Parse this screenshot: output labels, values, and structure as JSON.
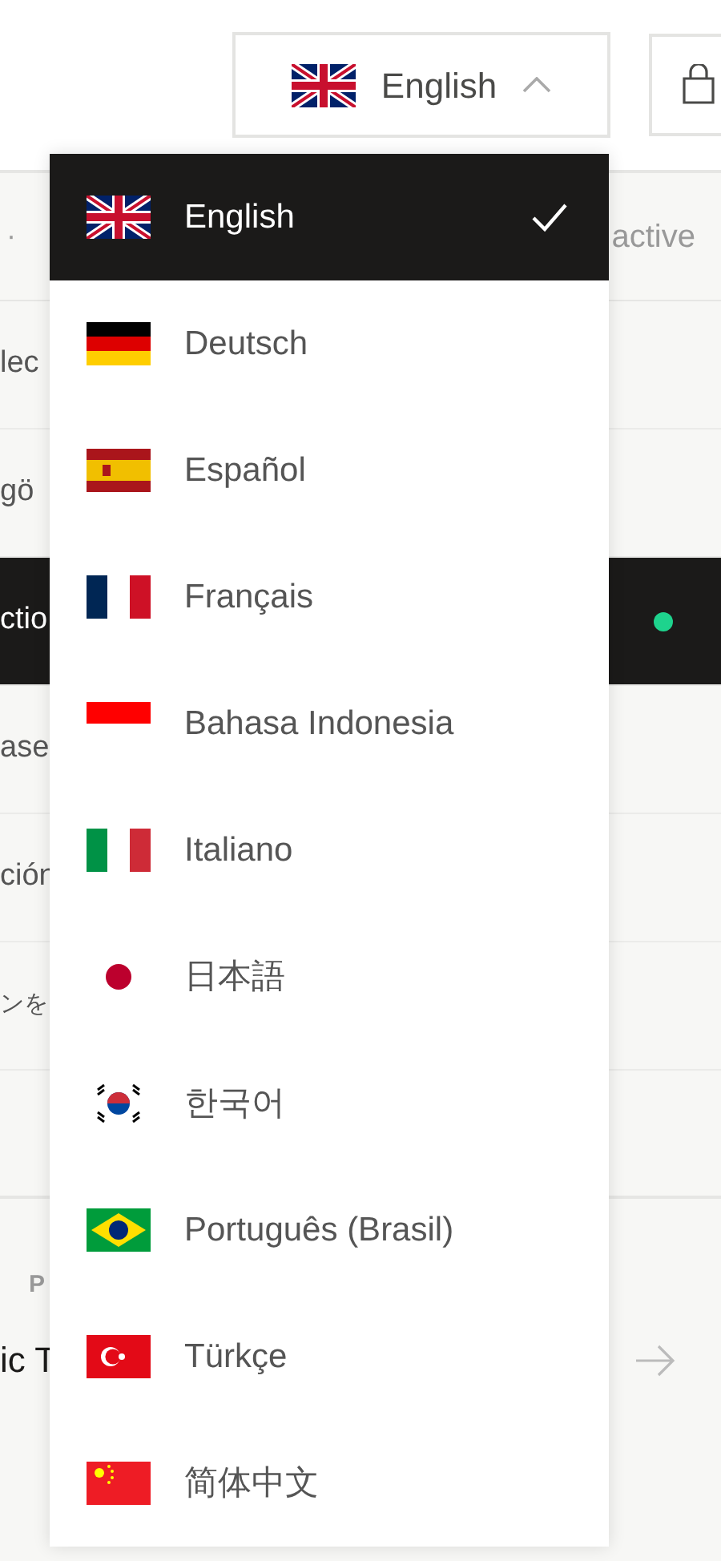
{
  "header": {
    "language_button": {
      "label": "English",
      "expanded": true
    }
  },
  "list": {
    "header_left": "·",
    "header_right": "active",
    "rows": [
      {
        "text": "lec",
        "selected": false,
        "active": false
      },
      {
        "text": "gö",
        "selected": false,
        "active": false
      },
      {
        "text": "ctio",
        "selected": true,
        "active": true
      },
      {
        "text": "ase",
        "selected": false,
        "active": false
      },
      {
        "text": "ción",
        "selected": false,
        "active": false
      },
      {
        "text": "ンを",
        "selected": false,
        "active": false
      }
    ]
  },
  "featured": {
    "label": "P",
    "title": "ic T"
  },
  "languages": [
    {
      "label": "English",
      "kind": "gb",
      "selected": true
    },
    {
      "label": "Deutsch",
      "kind": "de",
      "selected": false
    },
    {
      "label": "Español",
      "kind": "es",
      "selected": false
    },
    {
      "label": "Français",
      "kind": "fr",
      "selected": false
    },
    {
      "label": "Bahasa Indonesia",
      "kind": "id",
      "selected": false
    },
    {
      "label": "Italiano",
      "kind": "it",
      "selected": false
    },
    {
      "label": "日本語",
      "kind": "jp",
      "selected": false
    },
    {
      "label": "한국어",
      "kind": "kr",
      "selected": false
    },
    {
      "label": "Português (Brasil)",
      "kind": "br",
      "selected": false
    },
    {
      "label": "Türkçe",
      "kind": "tr",
      "selected": false
    },
    {
      "label": "简体中文",
      "kind": "cn",
      "selected": false
    }
  ]
}
